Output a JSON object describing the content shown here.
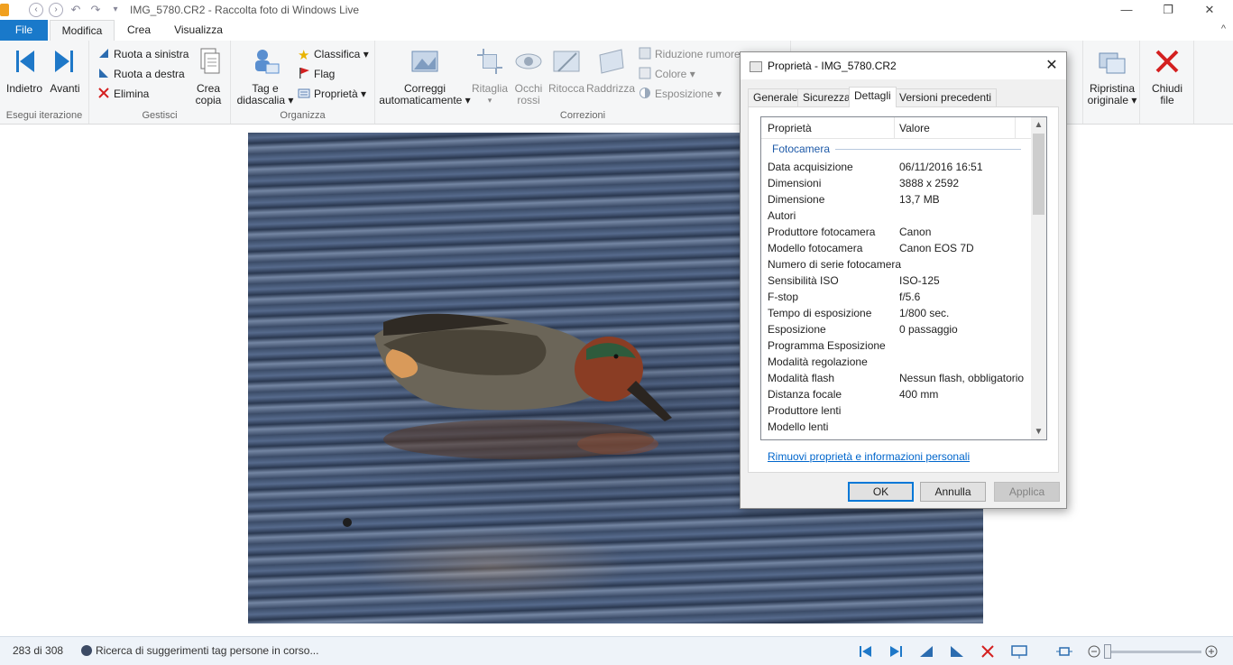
{
  "window": {
    "title": "IMG_5780.CR2 - Raccolta foto di Windows Live",
    "minimize": "—",
    "restore": "❐",
    "close": "✕"
  },
  "tabs": {
    "file": "File",
    "modifica": "Modifica",
    "crea": "Crea",
    "visualizza": "Visualizza",
    "help": "^"
  },
  "ribbon": {
    "iterazione": {
      "label": "Esegui iterazione",
      "indietro": "Indietro",
      "avanti": "Avanti"
    },
    "gestisci": {
      "label": "Gestisci",
      "ruota_sinistra": "Ruota a sinistra",
      "ruota_destra": "Ruota a destra",
      "elimina": "Elimina",
      "crea_copia_1": "Crea",
      "crea_copia_2": "copia"
    },
    "organizza": {
      "label": "Organizza",
      "tag_1": "Tag e",
      "tag_2": "didascalia",
      "classifica": "Classifica",
      "flag": "Flag",
      "proprieta": "Proprietà"
    },
    "correzioni": {
      "label": "Correzioni",
      "correggi_1": "Correggi",
      "correggi_2": "automaticamente",
      "ritaglia": "Ritaglia",
      "occhi_1": "Occhi",
      "occhi_2": "rossi",
      "ritocca": "Ritocca",
      "raddrizza": "Raddrizza",
      "riduzione_rumore": "Riduzione rumore",
      "colore": "Colore",
      "esposizione": "Esposizione"
    },
    "ripristina_1": "Ripristina",
    "ripristina_2": "originale",
    "chiudi_1": "Chiudi",
    "chiudi_2": "file"
  },
  "status": {
    "count": "283 di 308",
    "message": "Ricerca di suggerimenti tag persone in corso..."
  },
  "dialog": {
    "title": "Proprietà - IMG_5780.CR2",
    "tabs": [
      "Generale",
      "Sicurezza",
      "Dettagli",
      "Versioni precedenti"
    ],
    "header_property": "Proprietà",
    "header_value": "Valore",
    "category": "Fotocamera",
    "rows": [
      {
        "k": "Data acquisizione",
        "v": "06/11/2016 16:51"
      },
      {
        "k": "Dimensioni",
        "v": "3888 x 2592"
      },
      {
        "k": "Dimensione",
        "v": "13,7 MB"
      },
      {
        "k": "Autori",
        "v": ""
      },
      {
        "k": "Produttore fotocamera",
        "v": "Canon"
      },
      {
        "k": "Modello fotocamera",
        "v": "Canon EOS 7D"
      },
      {
        "k": "Numero di serie fotocamera",
        "v": ""
      },
      {
        "k": "Sensibilità ISO",
        "v": "ISO-125"
      },
      {
        "k": "F-stop",
        "v": "f/5.6"
      },
      {
        "k": "Tempo di esposizione",
        "v": "1/800 sec."
      },
      {
        "k": "Esposizione",
        "v": "0 passaggio"
      },
      {
        "k": "Programma Esposizione",
        "v": ""
      },
      {
        "k": "Modalità regolazione",
        "v": ""
      },
      {
        "k": "Modalità flash",
        "v": "Nessun flash, obbligatorio"
      },
      {
        "k": "Distanza focale",
        "v": "400 mm"
      },
      {
        "k": "Produttore lenti",
        "v": ""
      },
      {
        "k": "Modello lenti",
        "v": ""
      }
    ],
    "link": "Rimuovi proprietà e informazioni personali",
    "ok": "OK",
    "annulla": "Annulla",
    "applica": "Applica"
  }
}
